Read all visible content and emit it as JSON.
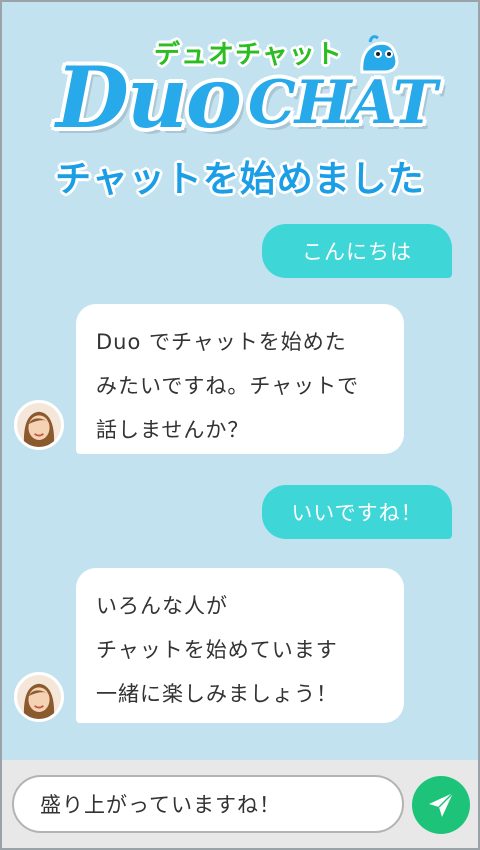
{
  "logo": {
    "kana": "デュオチャット",
    "word_duo": "Duo",
    "word_chat": "CHAT",
    "mascot_icon": "blue-blob-mascot-icon"
  },
  "header": {
    "subtitle": "チャットを始めました"
  },
  "messages": [
    {
      "sender": "me",
      "lines": [
        "こんにちは"
      ]
    },
    {
      "sender": "other",
      "lines": [
        "Duo でチャットを始めた",
        "みたいですね。チャットで",
        "話しませんか？"
      ]
    },
    {
      "sender": "me",
      "lines": [
        "いいですね！"
      ]
    },
    {
      "sender": "other",
      "lines": [
        "いろんな人が",
        "チャットを始めています",
        "一緒に楽しみましょう！"
      ]
    }
  ],
  "composer": {
    "value": "盛り上がっていますね！",
    "send_icon": "paper-plane-send-icon"
  },
  "colors": {
    "background": "#c2e2ef",
    "my_bubble": "#3fd6d8",
    "other_bubble": "#ffffff",
    "brand_blue": "#27a9ea",
    "brand_green": "#2bbd22",
    "send_button": "#1ec37a"
  }
}
